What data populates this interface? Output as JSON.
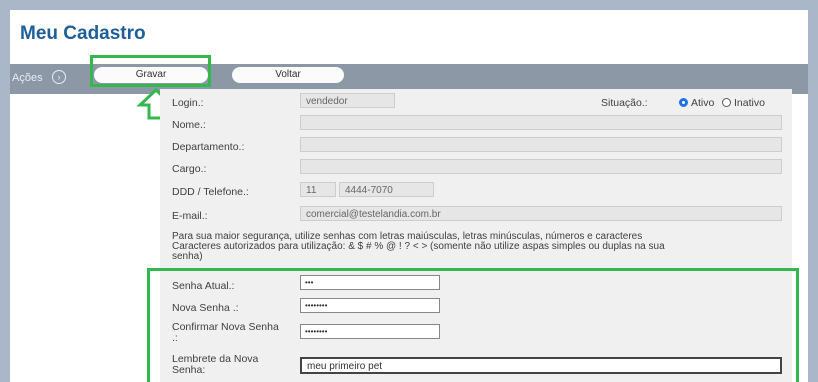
{
  "title": "Meu Cadastro",
  "actions": {
    "label": "Ações",
    "gravar": "Gravar",
    "voltar": "Voltar"
  },
  "form": {
    "login": {
      "label": "Login.:",
      "value": "vendedor"
    },
    "situacao": {
      "label": "Situação.:",
      "ativo": "Ativo",
      "inativo": "Inativo",
      "selected": "Ativo"
    },
    "nome": {
      "label": "Nome.:",
      "value": ""
    },
    "departamento": {
      "label": "Departamento.:",
      "value": ""
    },
    "cargo": {
      "label": "Cargo.:",
      "value": ""
    },
    "telefone": {
      "label": "DDD / Telefone.:",
      "ddd": "11",
      "numero": "4444-7070"
    },
    "email": {
      "label": "E-mail.:",
      "value": "comercial@testelandia.com.br"
    },
    "info_line1": "Para sua maior segurança, utilize senhas com letras maiúsculas, letras minúsculas, números e caracteres",
    "info_line2": "Caracteres autorizados para utilização: & $ # % @ ! ? < > (somente não utilize aspas simples ou duplas na sua",
    "info_line3": "senha)",
    "senha_atual": {
      "label": "Senha Atual.:",
      "value": "•••"
    },
    "nova_senha": {
      "label": "Nova Senha .:",
      "value": "••••••••"
    },
    "confirmar_senha": {
      "label": "Confirmar Nova Senha",
      "label2": ".:",
      "value": "••••••••"
    },
    "lembrete": {
      "label": "Lembrete da Nova",
      "label2": "Senha:",
      "value": "meu primeiro pet"
    }
  },
  "colors": {
    "highlight": "#33b84d",
    "title": "#1f5f99",
    "radio": "#1a73e8"
  }
}
